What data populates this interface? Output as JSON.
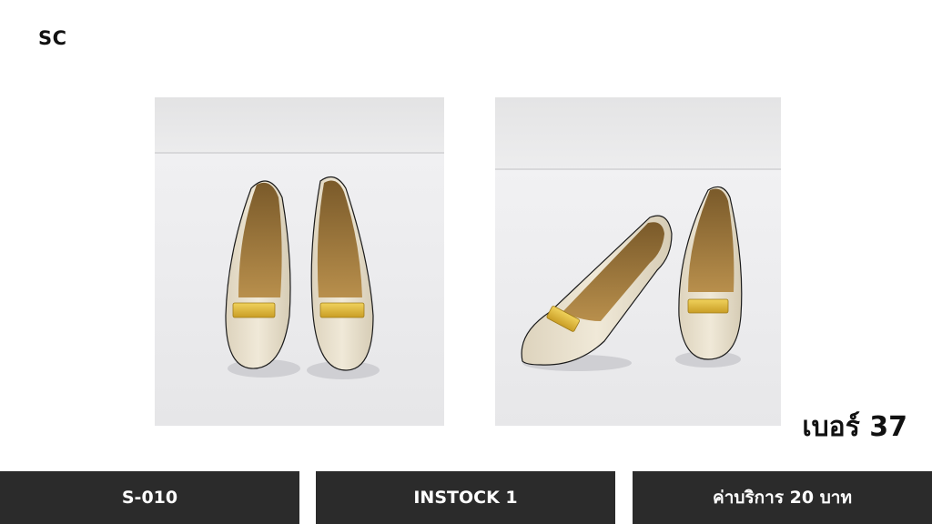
{
  "header": {
    "brand": "SC"
  },
  "photos": [
    {
      "icon": "shoe-pair-front-photo"
    },
    {
      "icon": "shoe-pair-angled-photo"
    }
  ],
  "product": {
    "size_label": "เบอร์ 37",
    "code": "S-010",
    "stock": "INSTOCK 1",
    "service_fee": "ค่าบริการ 20 บาท"
  },
  "colors": {
    "bar_background": "#2b2b2b",
    "bar_text": "#ffffff",
    "shoe_cream": "#e9e1cd",
    "buckle_gold": "#d9b53a"
  }
}
